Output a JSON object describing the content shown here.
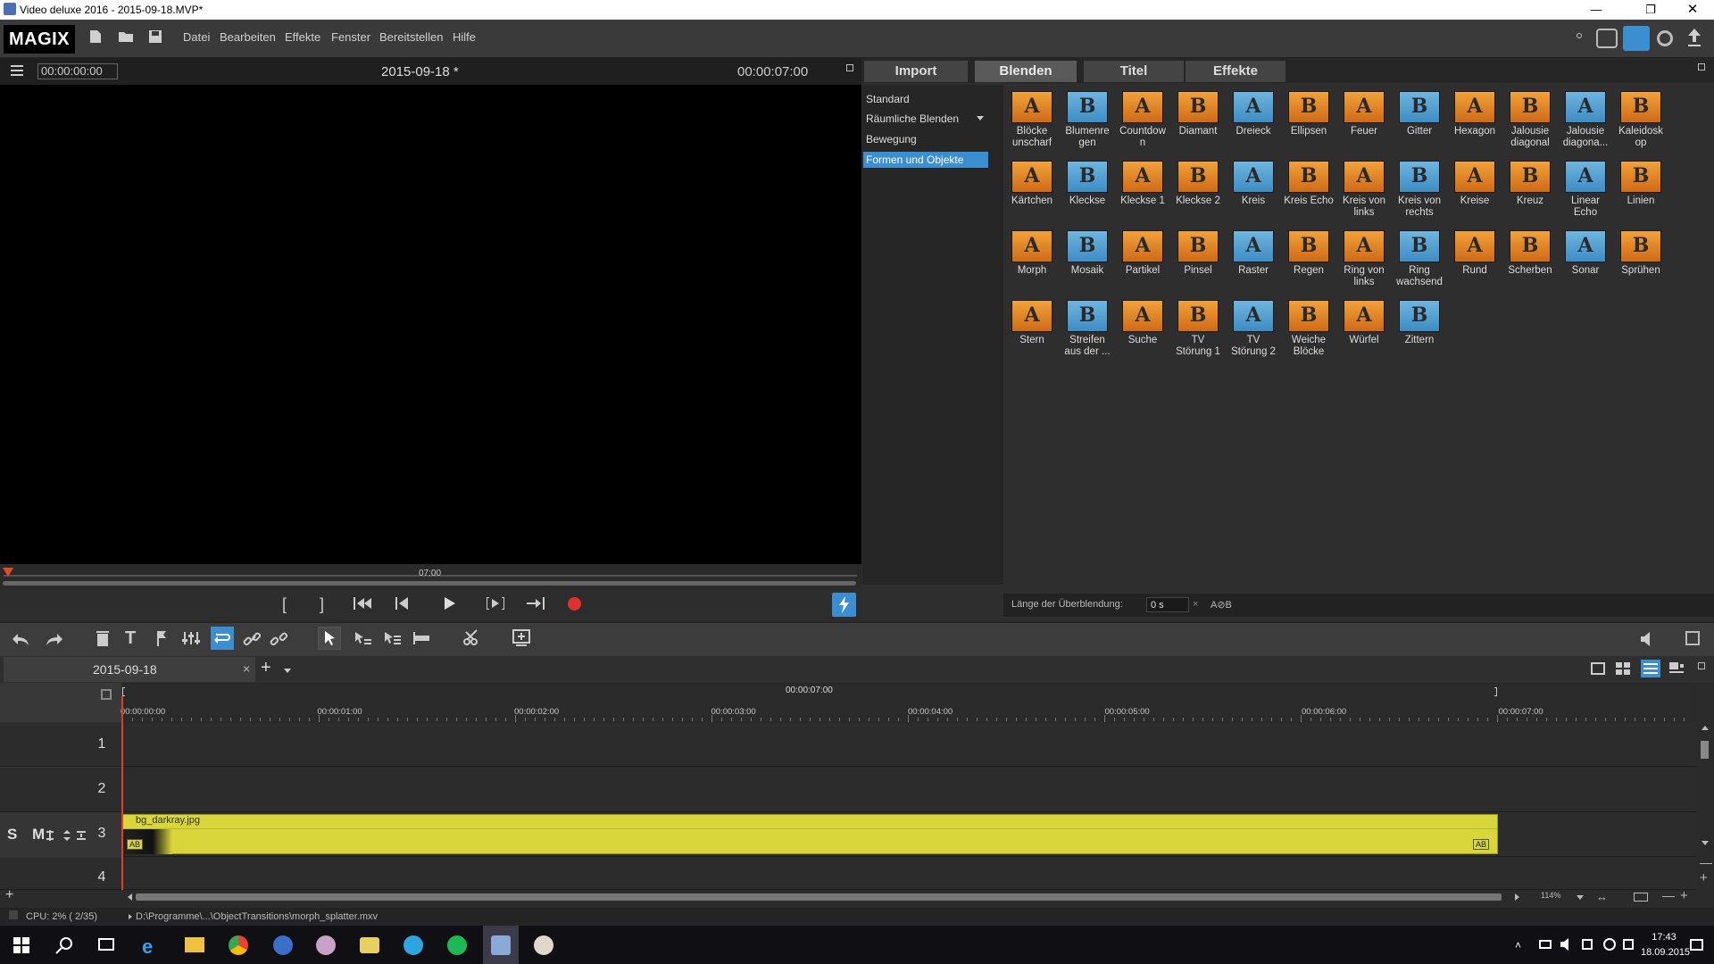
{
  "window": {
    "title": "Video deluxe 2016 - 2015-09-18.MVP*"
  },
  "menubar": {
    "logo": "MAGIX",
    "items": [
      "Datei",
      "Bearbeiten",
      "Effekte",
      "Fenster",
      "Bereitstellen",
      "Hilfe"
    ]
  },
  "preview": {
    "timecode_in": "00:00:00:00",
    "project": "2015-09-18 *",
    "timecode_total": "00:00:07:00",
    "scrub_marker": "07:00"
  },
  "panel": {
    "tabs": [
      "Import",
      "Blenden",
      "Titel",
      "Effekte"
    ],
    "active_tab": "Blenden",
    "categories": [
      "Standard",
      "Räumliche Blenden",
      "Bewegung",
      "Formen und Objekte"
    ],
    "selected_category": "Formen und Objekte",
    "transitions": [
      [
        "Blöcke unscharf",
        "Blumenregen",
        "Countdown",
        "Diamant",
        "Dreieck",
        "Ellipsen",
        "Feuer",
        "Gitter",
        "Hexagon",
        "Jalousie diagonal",
        "Jalousie diagona...",
        "Kaleidoskop"
      ],
      [
        "Kärtchen",
        "Kleckse",
        "Kleckse 1",
        "Kleckse 2",
        "Kreis",
        "Kreis Echo",
        "Kreis von links",
        "Kreis von rechts",
        "Kreise",
        "Kreuz",
        "Linear Echo",
        "Linien"
      ],
      [
        "Morph",
        "Mosaik",
        "Partikel",
        "Pinsel",
        "Raster",
        "Regen",
        "Ring von links",
        "Ring wachsend",
        "Rund",
        "Scherben",
        "Sonar",
        "Sprühen"
      ],
      [
        "Stern",
        "Streifen aus der ...",
        "Suche",
        "TV Störung 1",
        "TV Störung 2",
        "Weiche Blöcke",
        "Würfel",
        "Zittern"
      ]
    ],
    "transition_labels": [
      [
        "Blöcke\nunscharf",
        "Blumenre\ngen",
        "Countdow\nn",
        "Diamant",
        "Dreieck",
        "Ellipsen",
        "Feuer",
        "Gitter",
        "Hexagon",
        "Jalousie\ndiagonal",
        "Jalousie\ndiagona...",
        "Kaleidosk\nop"
      ],
      [
        "Kärtchen",
        "Kleckse",
        "Kleckse 1",
        "Kleckse 2",
        "Kreis",
        "Kreis Echo",
        "Kreis von\nlinks",
        "Kreis von\nrechts",
        "Kreise",
        "Kreuz",
        "Linear\nEcho",
        "Linien"
      ],
      [
        "Morph",
        "Mosaik",
        "Partikel",
        "Pinsel",
        "Raster",
        "Regen",
        "Ring von\nlinks",
        "Ring\nwachsend",
        "Rund",
        "Scherben",
        "Sonar",
        "Sprühen"
      ],
      [
        "Stern",
        "Streifen\naus der ...",
        "Suche",
        "TV\nStörung 1",
        "TV\nStörung 2",
        "Weiche\nBlöcke",
        "Würfel",
        "Zittern"
      ]
    ],
    "status": {
      "label": "Länge der Überblendung:",
      "value": "0 s",
      "ab": "A⊘B"
    }
  },
  "timeline": {
    "tab_name": "2015-09-18",
    "duration": "00:00:07:00",
    "ruler_ticks": [
      "00:00:00:00",
      "00:00:01:00",
      "00:00:02:00",
      "00:00:03:00",
      "00:00:04:00",
      "00:00:05:00",
      "00:00:06:00",
      "00:00:07:00"
    ],
    "tracks": [
      "1",
      "2",
      "3",
      "4"
    ],
    "track3_controls": "S M",
    "clip": {
      "name": "bg_darkray.jpg",
      "ab": "AB"
    },
    "zoom": "114%"
  },
  "status": {
    "cpu": "CPU: 2% ( 2/35)",
    "path": "D:\\Programme\\...\\ObjectTransitions\\morph_splatter.mxv"
  },
  "taskbar": {
    "time": "17:43",
    "date": "18.09.2015"
  },
  "colors": {
    "accent": "#3b8fd0",
    "clip": "#d8d63a",
    "record": "#e03030"
  }
}
